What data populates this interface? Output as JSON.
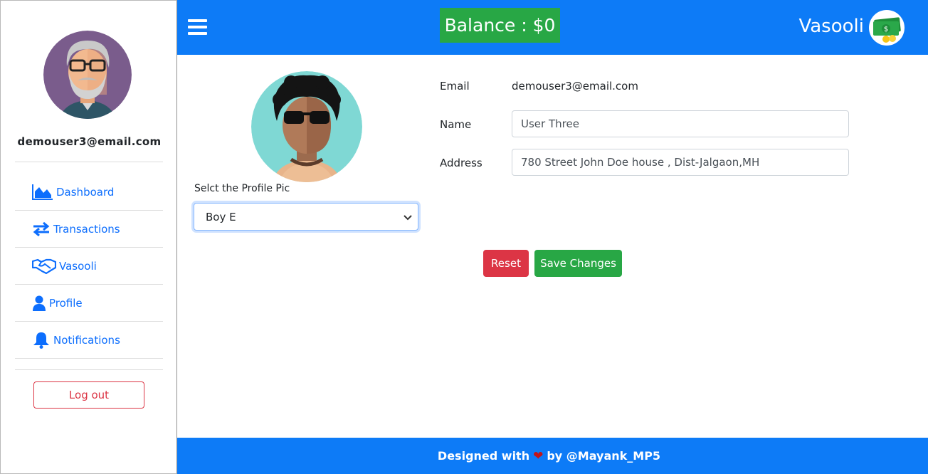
{
  "sidebar": {
    "user_email": "demouser3@email.com",
    "nav": [
      {
        "label": "Dashboard",
        "icon": "chart-area-icon"
      },
      {
        "label": "Transactions",
        "icon": "exchange-arrows-icon"
      },
      {
        "label": "Vasooli",
        "icon": "handshake-icon"
      },
      {
        "label": "Profile",
        "icon": "user-icon"
      },
      {
        "label": "Notifications",
        "icon": "bell-icon"
      }
    ],
    "logout_label": "Log out"
  },
  "header": {
    "balance": "Balance : $0",
    "brand": "Vasooli"
  },
  "profile": {
    "select_label": "Selct the Profile Pic",
    "selected_pic": "Boy E",
    "email_label": "Email",
    "email_value": "demouser3@email.com",
    "name_label": "Name",
    "name_value": "User Three",
    "address_label": "Address",
    "address_value": "780 Street John Doe house , Dist-Jalgaon,MH",
    "reset_label": "Reset",
    "save_label": "Save Changes"
  },
  "footer": {
    "prefix": "Designed with",
    "suffix": "by @Mayank_MP5"
  },
  "colors": {
    "primary": "#0d7bf7",
    "success": "#28a745",
    "danger": "#dc3545",
    "link": "#0d6efd"
  }
}
